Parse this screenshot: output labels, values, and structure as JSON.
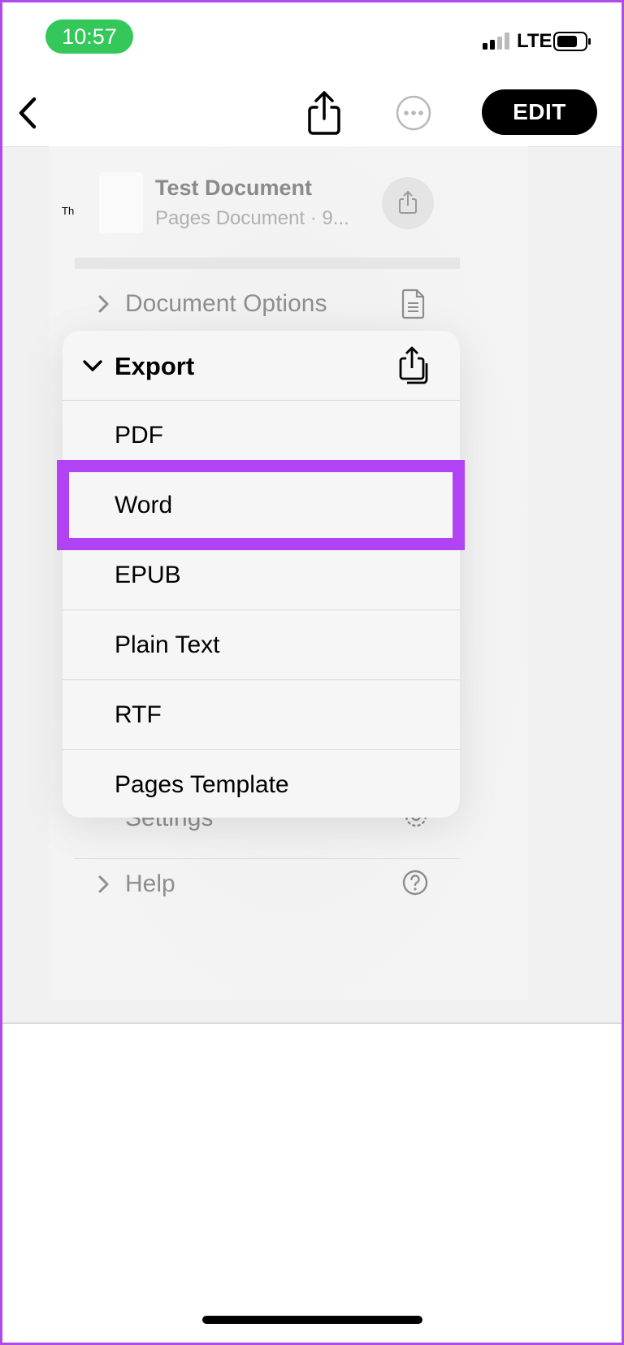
{
  "status_bar": {
    "time": "10:57",
    "network": "LTE"
  },
  "nav": {
    "edit_label": "EDIT"
  },
  "document": {
    "thumb_label": "Th",
    "title": "Test Document",
    "subtitle": "Pages Document · 9..."
  },
  "background_rows": {
    "document_options": "Document Options",
    "settings": "Settings",
    "help": "Help"
  },
  "export_menu": {
    "title": "Export",
    "items": [
      "PDF",
      "Word",
      "EPUB",
      "Plain Text",
      "RTF",
      "Pages Template"
    ]
  },
  "colors": {
    "time_pill": "#34c759",
    "highlight": "#b143f5",
    "frame": "#b04ae8"
  }
}
